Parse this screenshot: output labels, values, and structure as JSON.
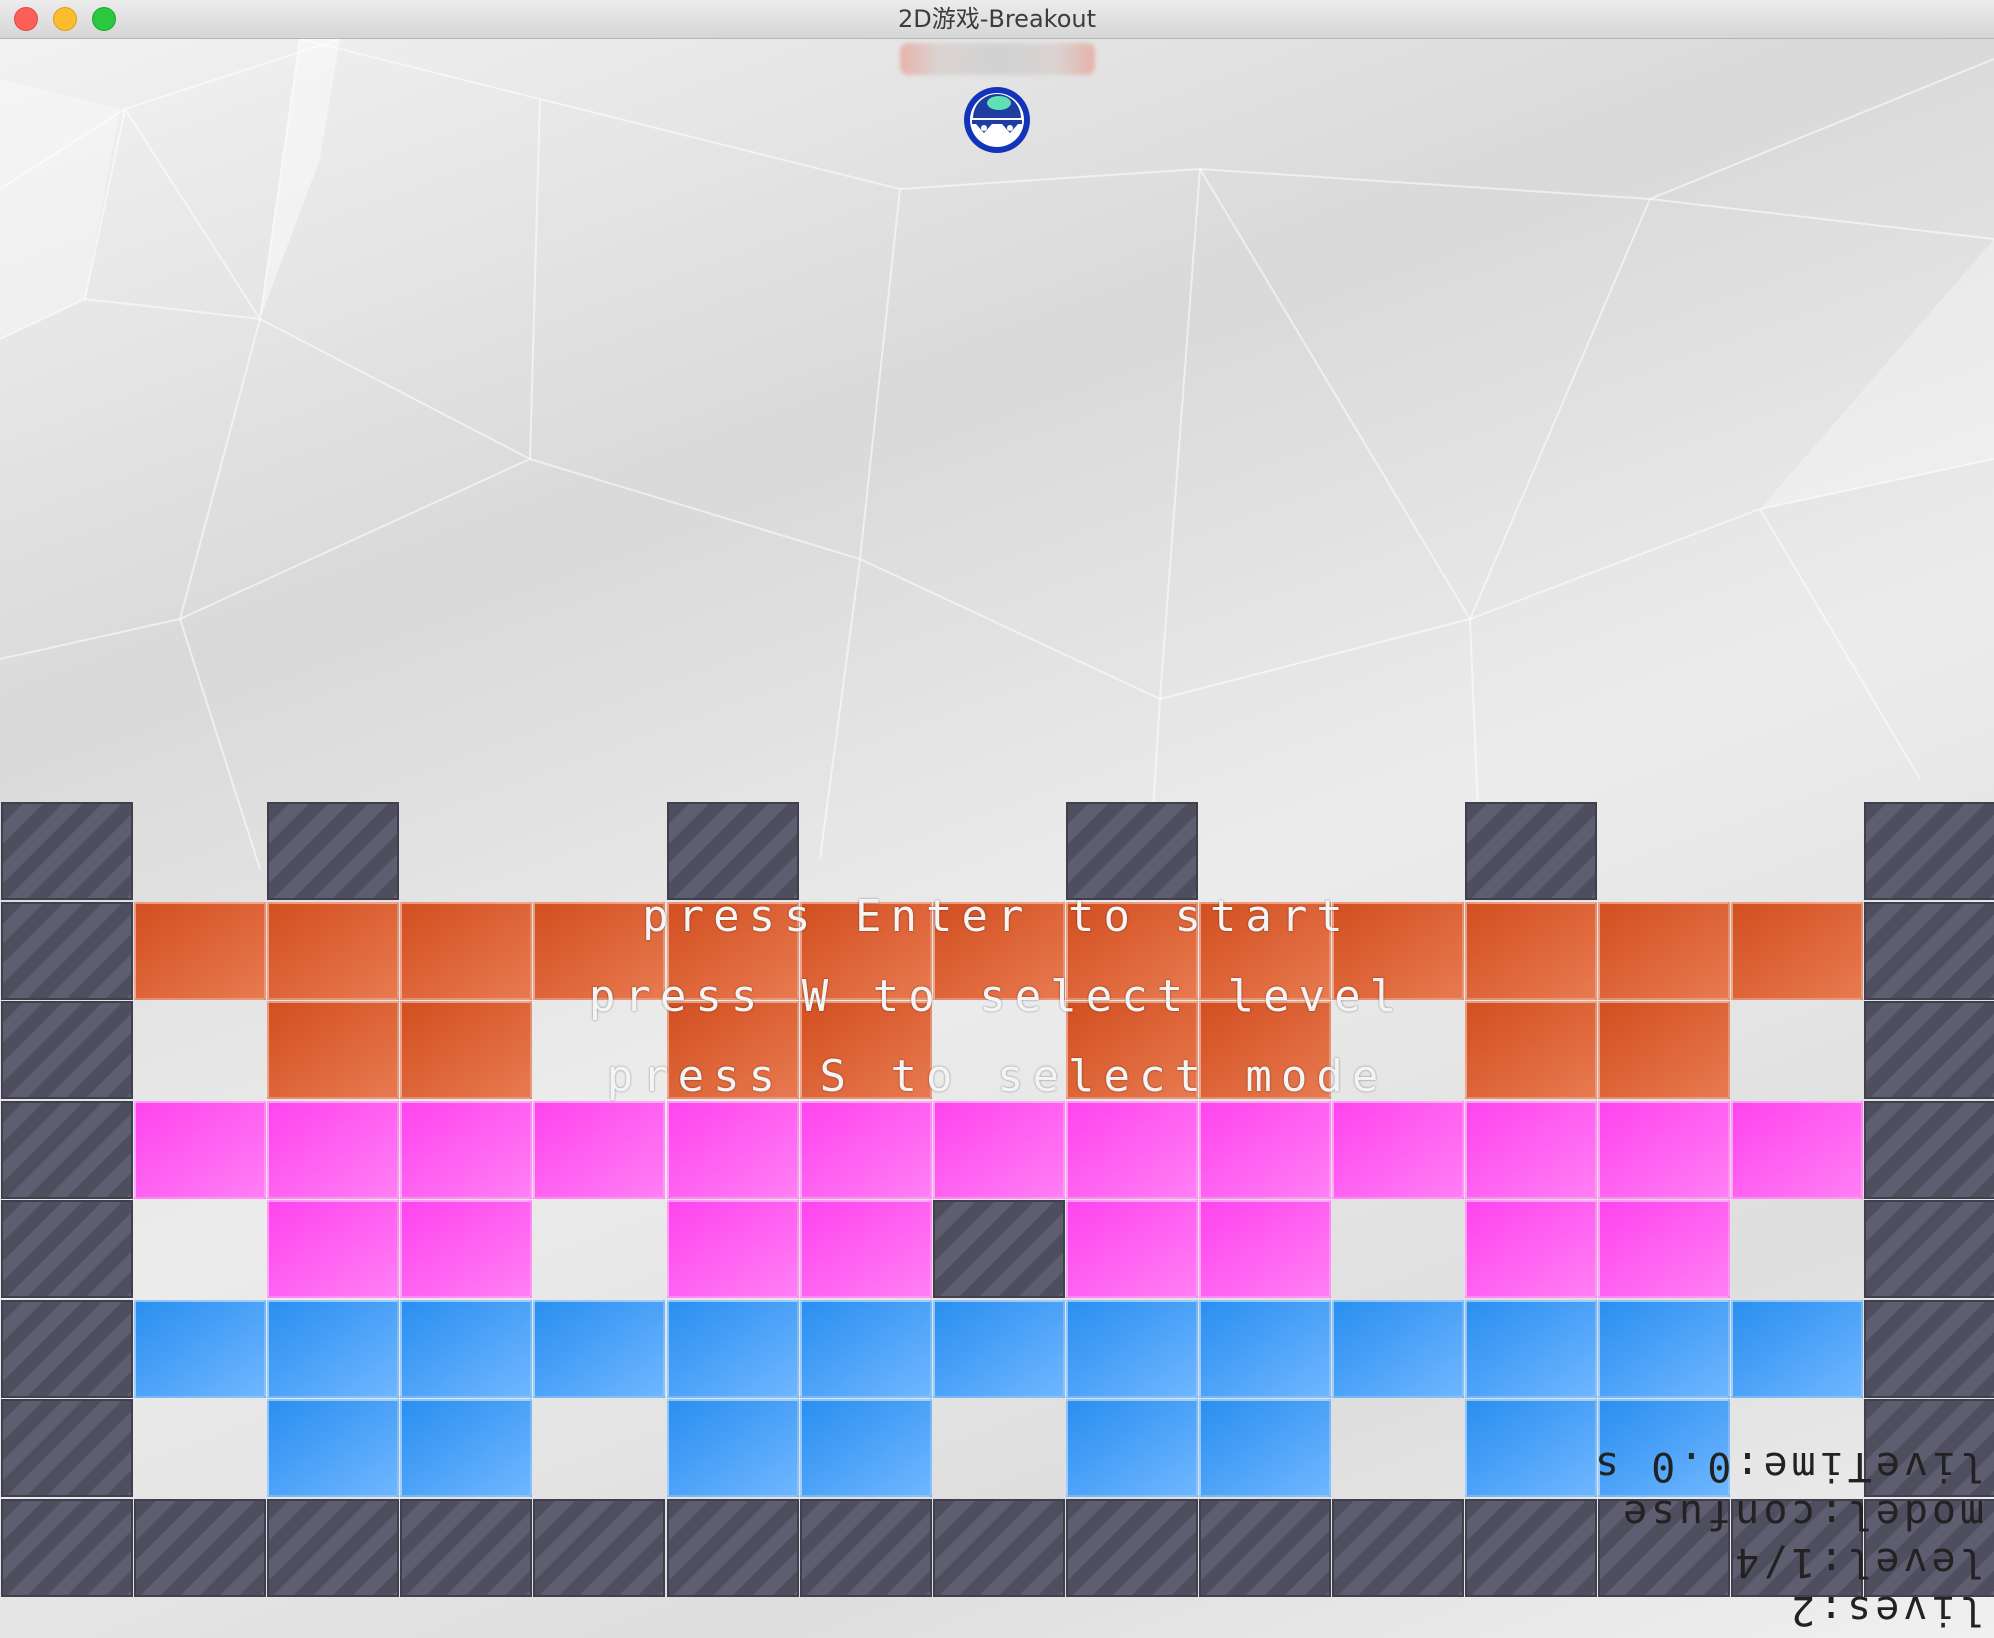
{
  "window": {
    "title": "2D游戏-Breakout",
    "buttons": [
      "close",
      "minimize",
      "zoom"
    ]
  },
  "game": {
    "paddle_icon": "paddle",
    "ball_icon": "face-ball",
    "menu": {
      "line1": "press Enter to start",
      "line2": "press W to select level",
      "line3": "press S to select mode"
    },
    "hud": {
      "livetime": "liveTime:0.0 s",
      "model": "model:confuse",
      "level": "level:1/4",
      "lives": "lives:2"
    },
    "colors": {
      "orange": "#d24f20",
      "pink": "#ff44ee",
      "blue": "#2a8ff0",
      "solid": "#4e4e5f"
    },
    "bricks": [
      "S0S0S0S0S0S0S",
      "S#########2#2#2#S",
      "S0000000000000S",
      "S#2##2#2#2##2#2#S",
      "S1111111111111S",
      "S#1#1##1#1#S#1#1##1#1##1#1#S",
      "S3333333333333S",
      "S#3#3##3#3##3#3##3#S"
    ]
  }
}
